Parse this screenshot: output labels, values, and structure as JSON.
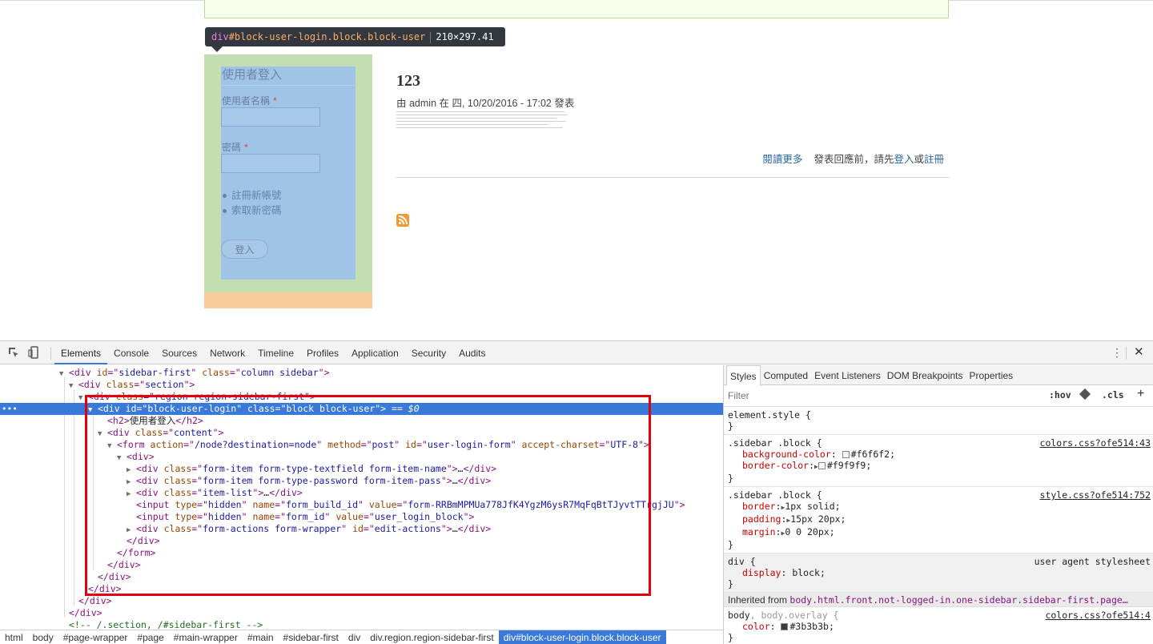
{
  "tooltip": {
    "tag": "div",
    "id_class": "#block-user-login.block.block-user",
    "size": "210×297.41"
  },
  "login_block": {
    "title": "使用者登入",
    "username_label": "使用者名稱",
    "password_label": "密碼",
    "required_mark": "*",
    "links": [
      "註冊新帳號",
      "索取新密碼"
    ],
    "submit_label": "登入"
  },
  "node": {
    "title": "123",
    "meta": "由 admin 在 四, 10/20/2016 - 17:02 發表",
    "read_more": "閱讀更多",
    "comment_prefix": "發表回應前，請先",
    "login_link": "登入",
    "or": "或",
    "register_link": "註冊"
  },
  "devtools": {
    "tabs": [
      "Elements",
      "Console",
      "Sources",
      "Network",
      "Timeline",
      "Profiles",
      "Application",
      "Security",
      "Audits"
    ],
    "active_tab": "Elements",
    "dom": {
      "r0": {
        "tag": "div",
        "id": "sidebar-first",
        "class": "column sidebar"
      },
      "r1": {
        "tag": "div",
        "class": "section"
      },
      "r2": {
        "tag": "div",
        "class": "region region-sidebar-first"
      },
      "r3": {
        "tag": "div",
        "id": "block-user-login",
        "class": "block block-user",
        "marker": "== $0"
      },
      "r4": {
        "open": "<h2>",
        "text": "使用者登入",
        "close": "</h2>"
      },
      "r5": {
        "tag": "div",
        "class": "content"
      },
      "r6": {
        "tag": "form",
        "action": "/node?destination=node",
        "method": "post",
        "id": "user-login-form",
        "charset": "UTF-8"
      },
      "r7": {
        "tag": "<div>"
      },
      "r8": {
        "class": "form-item form-type-textfield form-item-name"
      },
      "r9": {
        "class": "form-item form-type-password form-item-pass"
      },
      "r10": {
        "class": "item-list"
      },
      "r11": {
        "type": "hidden",
        "name": "form_build_id",
        "value": "form-RRBmMPMUa778JfK4YgzM6ysR7MqFqBtTJyvtTTrgjJU"
      },
      "r12": {
        "type": "hidden",
        "name": "form_id",
        "value": "user_login_block"
      },
      "r13": {
        "class": "form-actions form-wrapper",
        "id": "edit-actions"
      },
      "closes": {
        "div": "</div>",
        "form": "</form>"
      },
      "comment": "<!-- /.section, /#sidebar-first -->"
    },
    "breadcrumbs": [
      "html",
      "body",
      "#page-wrapper",
      "#page",
      "#main-wrapper",
      "#main",
      "#sidebar-first",
      "div",
      "div.region.region-sidebar-first",
      "div#block-user-login.block.block-user"
    ],
    "styles": {
      "tabs": [
        "Styles",
        "Computed",
        "Event Listeners",
        "DOM Breakpoints",
        "Properties"
      ],
      "filter_placeholder": "Filter",
      "hov": ":hov",
      "cls": ".cls",
      "rules": {
        "element": {
          "selector": "element.style {"
        },
        "r1": {
          "selector": ".sidebar .block {",
          "source": "colors.css?ofe514:43",
          "p1n": "background-color",
          "p1v": "#f6f6f2;",
          "p2n": "border-color",
          "p2v": "#f9f9f9;"
        },
        "r2": {
          "selector": ".sidebar .block {",
          "source": "style.css?ofe514:752",
          "p1n": "border",
          "p1v": "1px solid;",
          "p2n": "padding",
          "p2v": "15px 20px;",
          "p3n": "margin",
          "p3v": "0 0 20px;"
        },
        "r3": {
          "selector": "div {",
          "source": "user agent stylesheet",
          "p1n": "display",
          "p1v": "block;"
        },
        "inherited_label": "Inherited from",
        "inherited_selector": "body.html.front.not-logged-in.one-sidebar.sidebar-first.page…",
        "r4": {
          "selector_a": "body",
          "selector_b": ", body.overlay {",
          "source": "colors.css?ofe514:4",
          "p1n": "color",
          "p1v": "#3b3b3b;"
        },
        "close": "}"
      }
    }
  },
  "colors": {
    "accent": "#3879d9",
    "highlight_content": "#9fc4e7",
    "highlight_padding": "#c3deb1",
    "highlight_margin": "#f8cc9d",
    "annotation_box": "#e0000f"
  }
}
